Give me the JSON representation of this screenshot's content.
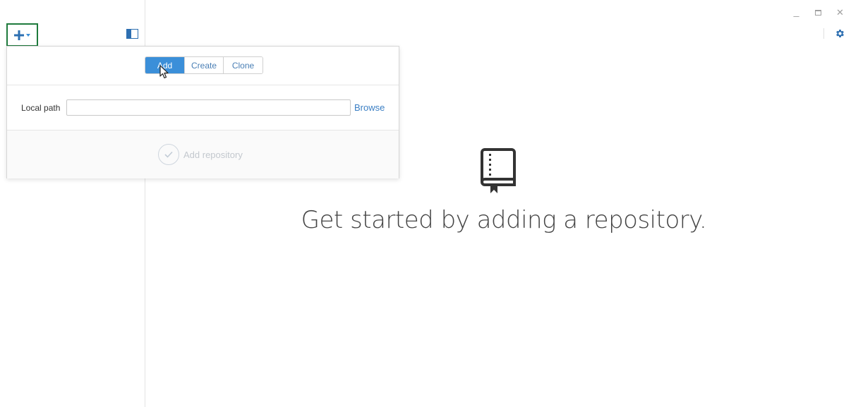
{
  "window": {
    "minimize_label": "_",
    "close_label": "✕"
  },
  "sidebar": {
    "add_menu_icon": "plus-icon",
    "toggle_icon": "sidebar-panel-icon"
  },
  "popover": {
    "tabs": [
      {
        "label": "Add",
        "active": true
      },
      {
        "label": "Create",
        "active": false
      },
      {
        "label": "Clone",
        "active": false
      }
    ],
    "local_path_label": "Local path",
    "local_path_value": "",
    "browse_label": "Browse",
    "add_repository_label": "Add repository"
  },
  "empty_state": {
    "icon": "repo-book-icon",
    "message": "Get started by adding a repository."
  },
  "colors": {
    "accent": "#3b8fd9",
    "highlight_border": "#1e7a3c",
    "link": "#3b7fc4"
  }
}
